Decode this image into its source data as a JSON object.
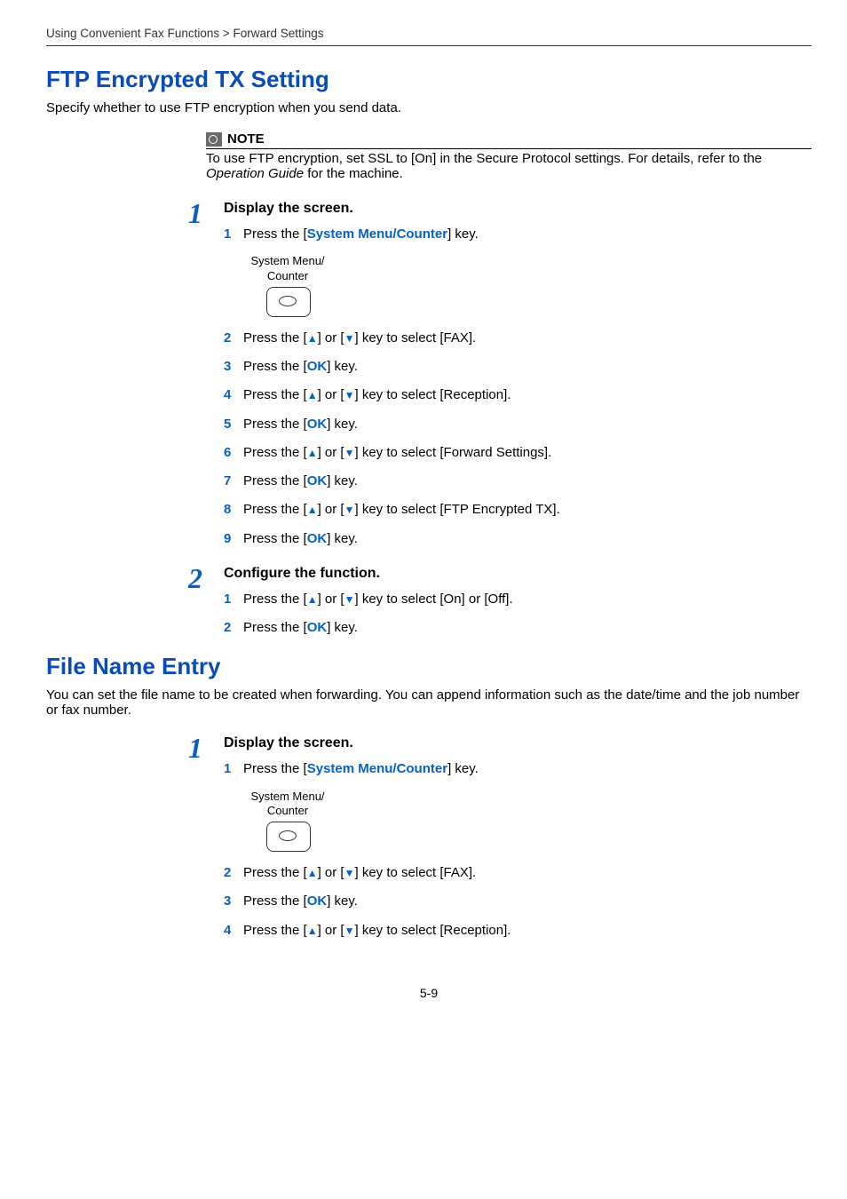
{
  "breadcrumb": "Using Convenient Fax Functions > Forward Settings",
  "section1": {
    "title": "FTP Encrypted TX Setting",
    "intro": "Specify whether to use FTP encryption when you send data.",
    "note_label": "NOTE",
    "note_pre": "To use FTP encryption, set SSL to [On] in the Secure Protocol settings. For details, refer to the ",
    "note_italic": "Operation Guide",
    "note_post": " for the machine.",
    "step1": {
      "title": "Display the screen.",
      "items": {
        "i1_pre": "Press the [",
        "i1_key": "System Menu/Counter",
        "i1_post": "] key.",
        "phys_line1": "System Menu/",
        "phys_line2": "Counter",
        "i2_pre": "Press the [",
        "i2_mid": "] or [",
        "i2_post": "] key to select [FAX].",
        "i3_pre": "Press the [",
        "i3_key": "OK",
        "i3_post": "] key.",
        "i4_pre": "Press the [",
        "i4_mid": "] or [",
        "i4_post": "] key to select [Reception].",
        "i5_pre": "Press the [",
        "i5_key": "OK",
        "i5_post": "] key.",
        "i6_pre": "Press the [",
        "i6_mid": "] or [",
        "i6_post": "] key to select [Forward Settings].",
        "i7_pre": "Press the [",
        "i7_key": "OK",
        "i7_post": "] key.",
        "i8_pre": "Press the [",
        "i8_mid": "] or [",
        "i8_post": "] key to select [FTP Encrypted TX].",
        "i9_pre": "Press the [",
        "i9_key": "OK",
        "i9_post": "] key."
      }
    },
    "step2": {
      "title": "Configure the function.",
      "items": {
        "i1_pre": "Press the [",
        "i1_mid": "] or [",
        "i1_post": "] key to select [On] or [Off].",
        "i2_pre": "Press the [",
        "i2_key": "OK",
        "i2_post": "] key."
      }
    }
  },
  "section2": {
    "title": "File Name Entry",
    "intro": "You can set the file name to be created when forwarding. You can append information such as the date/time and the job number or fax number.",
    "step1": {
      "title": "Display the screen.",
      "items": {
        "i1_pre": "Press the [",
        "i1_key": "System Menu/Counter",
        "i1_post": "] key.",
        "phys_line1": "System Menu/",
        "phys_line2": "Counter",
        "i2_pre": "Press the [",
        "i2_mid": "] or [",
        "i2_post": "] key to select [FAX].",
        "i3_pre": "Press the [",
        "i3_key": "OK",
        "i3_post": "] key.",
        "i4_pre": "Press the [",
        "i4_mid": "] or [",
        "i4_post": "] key to select [Reception]."
      }
    }
  },
  "page_number": "5-9",
  "nums": {
    "n1": "1",
    "n2": "2",
    "n3": "3",
    "n4": "4",
    "n5": "5",
    "n6": "6",
    "n7": "7",
    "n8": "8",
    "n9": "9"
  },
  "glyph": {
    "up": "▲",
    "down": "▼"
  }
}
